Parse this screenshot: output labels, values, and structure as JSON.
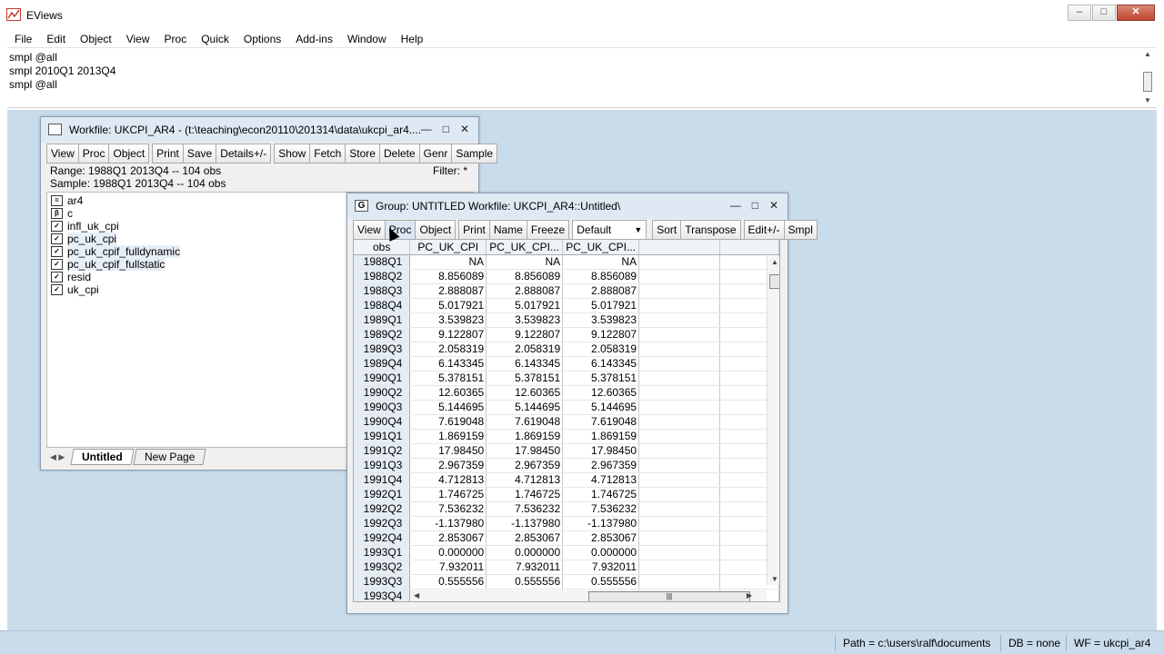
{
  "app": {
    "title": "EViews",
    "minimize": "–",
    "restore": "□",
    "close": "✕"
  },
  "menu": [
    "File",
    "Edit",
    "Object",
    "View",
    "Proc",
    "Quick",
    "Options",
    "Add-ins",
    "Window",
    "Help"
  ],
  "command_lines": [
    "smpl @all",
    "smpl 2010Q1 2013Q4",
    "smpl @all"
  ],
  "workfile": {
    "title": "Workfile: UKCPI_AR4 - (t:\\teaching\\econ20110\\201314\\data\\ukcpi_ar4....",
    "toolbar": [
      "View",
      "Proc",
      "Object",
      "Print",
      "Save",
      "Details+/-",
      "Show",
      "Fetch",
      "Store",
      "Delete",
      "Genr",
      "Sample"
    ],
    "range": "Range:  1988Q1 2013Q4  --  104 obs",
    "sample": "Sample: 1988Q1 2013Q4  --  104 obs",
    "filter": "Filter: *",
    "objects": [
      {
        "name": "ar4",
        "icon": "="
      },
      {
        "name": "c",
        "icon": "β"
      },
      {
        "name": "infl_uk_cpi",
        "icon": "✓"
      },
      {
        "name": "pc_uk_cpi",
        "icon": "✓"
      },
      {
        "name": "pc_uk_cpif_fulldynamic",
        "icon": "✓"
      },
      {
        "name": "pc_uk_cpif_fullstatic",
        "icon": "✓"
      },
      {
        "name": "resid",
        "icon": "✓"
      },
      {
        "name": "uk_cpi",
        "icon": "✓"
      }
    ],
    "tabs": [
      "Untitled",
      "New Page"
    ]
  },
  "group": {
    "title": "Group: UNTITLED   Workfile: UKCPI_AR4::Untitled\\",
    "icon_letter": "G",
    "toolbar": [
      "View",
      "Proc",
      "Object",
      "Print",
      "Name",
      "Freeze"
    ],
    "combo": "Default",
    "toolbar2": [
      "Sort",
      "Transpose",
      "Edit+/-",
      "Smpl"
    ],
    "columns": [
      "obs",
      "PC_UK_CPI",
      "PC_UK_CPI...",
      "PC_UK_CPI..."
    ],
    "rows": [
      [
        "1988Q1",
        "NA",
        "NA",
        "NA"
      ],
      [
        "1988Q2",
        "8.856089",
        "8.856089",
        "8.856089"
      ],
      [
        "1988Q3",
        "2.888087",
        "2.888087",
        "2.888087"
      ],
      [
        "1988Q4",
        "5.017921",
        "5.017921",
        "5.017921"
      ],
      [
        "1989Q1",
        "3.539823",
        "3.539823",
        "3.539823"
      ],
      [
        "1989Q2",
        "9.122807",
        "9.122807",
        "9.122807"
      ],
      [
        "1989Q3",
        "2.058319",
        "2.058319",
        "2.058319"
      ],
      [
        "1989Q4",
        "6.143345",
        "6.143345",
        "6.143345"
      ],
      [
        "1990Q1",
        "5.378151",
        "5.378151",
        "5.378151"
      ],
      [
        "1990Q2",
        "12.60365",
        "12.60365",
        "12.60365"
      ],
      [
        "1990Q3",
        "5.144695",
        "5.144695",
        "5.144695"
      ],
      [
        "1990Q4",
        "7.619048",
        "7.619048",
        "7.619048"
      ],
      [
        "1991Q1",
        "1.869159",
        "1.869159",
        "1.869159"
      ],
      [
        "1991Q2",
        "17.98450",
        "17.98450",
        "17.98450"
      ],
      [
        "1991Q3",
        "2.967359",
        "2.967359",
        "2.967359"
      ],
      [
        "1991Q4",
        "4.712813",
        "4.712813",
        "4.712813"
      ],
      [
        "1992Q1",
        "1.746725",
        "1.746725",
        "1.746725"
      ],
      [
        "1992Q2",
        "7.536232",
        "7.536232",
        "7.536232"
      ],
      [
        "1992Q3",
        "-1.137980",
        "-1.137980",
        "-1.137980"
      ],
      [
        "1992Q4",
        "2.853067",
        "2.853067",
        "2.853067"
      ],
      [
        "1993Q1",
        "0.000000",
        "0.000000",
        "0.000000"
      ],
      [
        "1993Q2",
        "7.932011",
        "7.932011",
        "7.932011"
      ],
      [
        "1993Q3",
        "0.555556",
        "0.555556",
        "0.555556"
      ],
      [
        "1993Q4",
        "",
        "",
        ""
      ]
    ]
  },
  "status": {
    "path": "Path = c:\\users\\ralf\\documents",
    "db": "DB = none",
    "wf": "WF = ukcpi_ar4"
  }
}
